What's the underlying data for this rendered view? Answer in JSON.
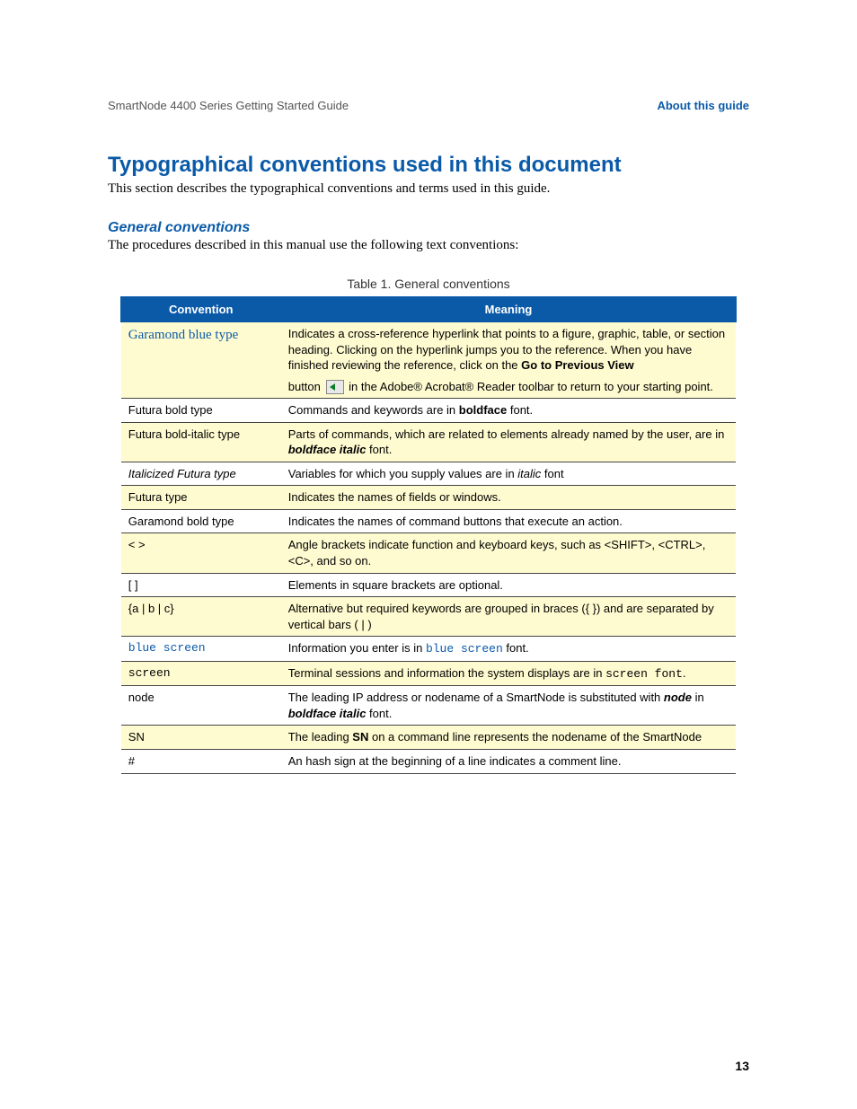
{
  "header": {
    "left": "SmartNode 4400 Series Getting Started Guide",
    "right": "About this guide"
  },
  "title": "Typographical conventions used in this document",
  "intro": "This section describes the typographical conventions and terms used in this guide.",
  "subhead": "General conventions",
  "subintro": "The procedures described in this manual use the following text conventions:",
  "tableCaption": "Table 1. General conventions",
  "th1": "Convention",
  "th2": "Meaning",
  "rows": {
    "r0c": "Garamond blue type",
    "r0m_a": "Indicates a cross-reference hyperlink that points to a figure, graphic, table, or section heading. Clicking on the hyperlink jumps you to the reference. When you have finished reviewing the reference, click on the ",
    "r0m_b": "Go to Previous View",
    "r0m_c": "button ",
    "r0m_d": " in the Adobe® Acrobat® Reader toolbar to return to your starting point.",
    "r1c": "Futura bold type",
    "r1m_a": "Commands and keywords are in ",
    "r1m_b": "boldface",
    "r1m_c": " font.",
    "r2c": "Futura bold-italic type",
    "r2m_a": "Parts of commands, which are related to elements already named by the user, are in ",
    "r2m_b": "boldface italic",
    "r2m_c": " font.",
    "r3c": "Italicized Futura type",
    "r3m_a": "Variables for which you supply values are in ",
    "r3m_b": "italic",
    "r3m_c": " font",
    "r4c": "Futura type",
    "r4m": "Indicates the names of fields or windows.",
    "r5c": "Garamond bold type",
    "r5m": "Indicates the names of command buttons that execute an action.",
    "r6c": "< >",
    "r6m": "Angle brackets indicate function and keyboard keys, such as <SHIFT>, <CTRL>, <C>, and so on.",
    "r7c": "[ ]",
    "r7m": "Elements in square brackets are optional.",
    "r8c": "{a | b | c}",
    "r8m": "Alternative but required keywords are grouped in braces ({ }) and are separated by vertical bars ( | )",
    "r9c": "blue screen",
    "r9m_a": "Information you enter is in ",
    "r9m_b": "blue screen",
    "r9m_c": " font.",
    "r10c": "screen",
    "r10m_a": "Terminal sessions and information the system displays are in ",
    "r10m_b": "screen font",
    "r10m_c": ".",
    "r11c": "node",
    "r11m_a": "The leading IP address or nodename of a SmartNode is substituted with ",
    "r11m_b": "node",
    "r11m_c": " in ",
    "r11m_d": "boldface italic",
    "r11m_e": " font.",
    "r12c": "SN",
    "r12m_a": "The leading ",
    "r12m_b": "SN",
    "r12m_c": " on a command line represents the nodename of the SmartNode",
    "r13c": "#",
    "r13m": "An hash sign at the beginning of a line indicates a comment line."
  },
  "pageNumber": "13"
}
